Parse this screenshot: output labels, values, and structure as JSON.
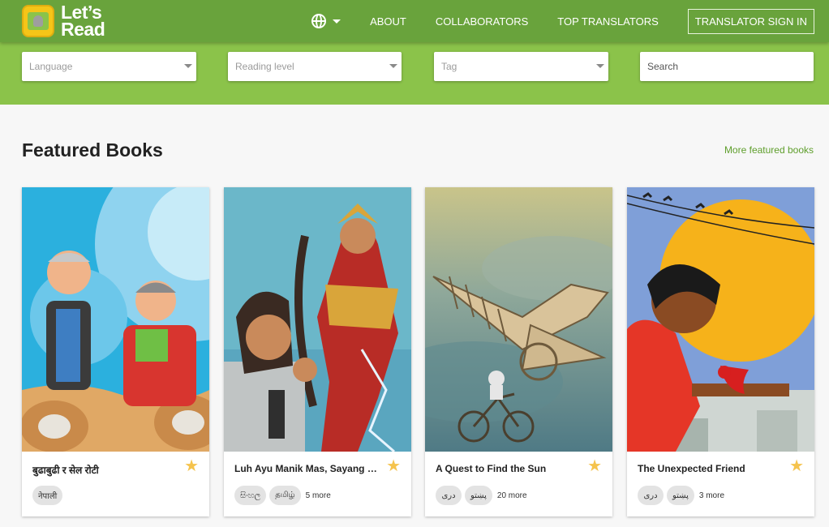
{
  "header": {
    "logo_line1": "Let’s",
    "logo_line2": "Read",
    "logo_icon": "elephant-logo",
    "language_icon": "globe-icon",
    "nav": [
      "ABOUT",
      "COLLABORATORS",
      "TOP TRANSLATORS"
    ],
    "signin_label": "TRANSLATOR SIGN IN"
  },
  "filters": {
    "language_placeholder": "Language",
    "reading_level_placeholder": "Reading level",
    "tag_placeholder": "Tag",
    "search_placeholder": "Search"
  },
  "section": {
    "title": "Featured Books",
    "more_link": "More featured books"
  },
  "books": [
    {
      "title": "बुढाबुढी र सेल रोटी",
      "chips": [
        "नेपाली"
      ],
      "more": ""
    },
    {
      "title": "Luh Ayu Manik Mas, Sayang Hu...",
      "chips": [
        "සිංහල",
        "தமிழ்"
      ],
      "more": "5 more"
    },
    {
      "title": "A Quest to Find the Sun",
      "chips": [
        "دری",
        "پښتو"
      ],
      "more": "20 more"
    },
    {
      "title": "The Unexpected Friend",
      "chips": [
        "دری",
        "پښتو"
      ],
      "more": "3 more"
    }
  ],
  "colors": {
    "header_green": "#69a33c",
    "filter_green": "#8bc34a",
    "link_green": "#5e9e2b",
    "star": "#f5c34d"
  }
}
